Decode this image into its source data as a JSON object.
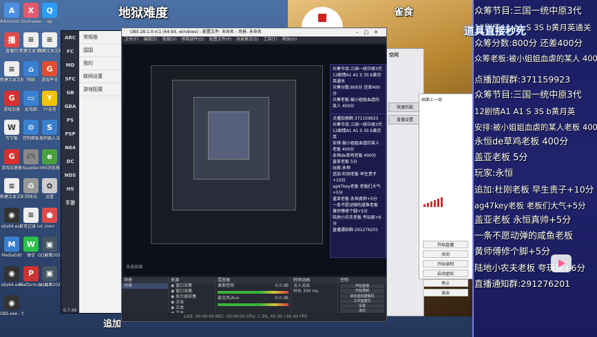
{
  "overlay": {
    "title_left": "地狱难度",
    "title_right": "雀食",
    "caption_float": "道具直接秒死",
    "bottom_text": "追加"
  },
  "desktop": {
    "icons": [
      {
        "label": "Administr...",
        "icon": "user-folder-icon",
        "color": "#4a8fe0",
        "glyph": "A"
      },
      {
        "label": "XiuXiuexe",
        "icon": "app-icon",
        "color": "#e05a6e",
        "glyph": "X"
      },
      {
        "label": "qq",
        "icon": "qq-icon",
        "color": "#2a9df4",
        "glyph": "Q"
      },
      {
        "label": "直播间",
        "icon": "live-icon",
        "color": "#e04a4a",
        "glyph": "播"
      },
      {
        "label": "新建文本文档(2).txt",
        "icon": "text-file-icon",
        "color": "#eeeeee",
        "glyph": "≡"
      },
      {
        "label": "新建文本文档.txt",
        "icon": "text-file-icon",
        "color": "#eeeeee",
        "glyph": "≡"
      },
      {
        "label": "新建文本文档(3).txt",
        "icon": "text-file-icon",
        "color": "#eeeeee",
        "glyph": "≡"
      },
      {
        "label": "网络",
        "icon": "network-icon",
        "color": "#3a80d0",
        "glyph": "⌂"
      },
      {
        "label": "游戏平台",
        "icon": "game-platform-icon",
        "color": "#e05030",
        "glyph": "G"
      },
      {
        "label": "游戏加速",
        "icon": "accelerator-icon",
        "color": "#d83030",
        "glyph": "G"
      },
      {
        "label": "此电脑",
        "icon": "computer-icon",
        "color": "#3a80d0",
        "glyph": "▭"
      },
      {
        "label": "YY语音",
        "icon": "yy-icon",
        "color": "#f2c200",
        "glyph": "Y"
      },
      {
        "label": "写字板",
        "icon": "wordpad-icon",
        "color": "#eeeeee",
        "glyph": "W"
      },
      {
        "label": "控制面板",
        "icon": "control-panel-icon",
        "color": "#3a80d0",
        "glyph": "⚙"
      },
      {
        "label": "搜狗输入法",
        "icon": "sogou-icon",
        "color": "#3a80d0",
        "glyph": "S"
      },
      {
        "label": "游戏加速器",
        "icon": "game-booster-icon",
        "color": "#d83030",
        "glyph": "G"
      },
      {
        "label": "Xpadder",
        "icon": "gamepad-icon",
        "color": "#888888",
        "glyph": "🎮"
      },
      {
        "label": "360浏览器",
        "icon": "browser-icon",
        "color": "#4aa040",
        "glyph": "e"
      },
      {
        "label": "新建文本文档(4).txt",
        "icon": "text-file-icon",
        "color": "#eeeeee",
        "glyph": "≡"
      },
      {
        "label": "回收站",
        "icon": "recycle-bin-icon",
        "color": "#999999",
        "glyph": "♻"
      },
      {
        "label": "设置",
        "icon": "settings-icon",
        "color": "#cccccc",
        "glyph": "✿"
      },
      {
        "label": "obs64.exe",
        "icon": "obs-icon",
        "color": "#333333",
        "glyph": "◉"
      },
      {
        "label": "日常记录.txt",
        "icon": "text-file-icon",
        "color": "#eeeeee",
        "glyph": "≡"
      },
      {
        "label": "mmr",
        "icon": "record-icon",
        "color": "#e04a4a",
        "glyph": "●"
      },
      {
        "label": "MediaEdit",
        "icon": "media-icon",
        "color": "#3a80d0",
        "glyph": "M"
      },
      {
        "label": "微信",
        "icon": "wechat-icon",
        "color": "#2cc04a",
        "glyph": "W"
      },
      {
        "label": "QQ截图20221...",
        "icon": "image-icon",
        "color": "#445566",
        "glyph": "▣"
      },
      {
        "label": "obs64.exe",
        "icon": "obs-icon",
        "color": "#333333",
        "glyph": "◉"
      },
      {
        "label": "Platform.exe",
        "icon": "platform-icon",
        "color": "#cc3333",
        "glyph": "P"
      },
      {
        "label": "QQ截图20221...",
        "icon": "image-icon",
        "color": "#445566",
        "glyph": "▣"
      },
      {
        "label": "OBS.exe - 快捷方式",
        "icon": "obs-icon",
        "color": "#333333",
        "glyph": "◉"
      }
    ]
  },
  "emulator": {
    "systems": [
      "ARC",
      "FC",
      "MD",
      "SFC",
      "GB",
      "GBA",
      "PS",
      "PSP",
      "N64",
      "DC",
      "NDS",
      "HS",
      "手游"
    ],
    "rows": [
      "常规版",
      "国国",
      "我的",
      "联网设置",
      "游戏配置"
    ],
    "version": "0.7.49"
  },
  "obs": {
    "title": "OBS 28.1.0-rc1 (64-bit, windows) - 配置文件: 未命名 - 场景: 未命名",
    "menu": [
      "文件(F)",
      "编辑(E)",
      "视图(V)",
      "停靠部件(D)",
      "配置文件(P)",
      "场景集合(S)",
      "工具(T)",
      "帮助(H)"
    ],
    "docks": {
      "scenes_header": "场景",
      "scenes": [
        "场景"
      ],
      "sources_header": "来源",
      "sources": [
        "窗口采集",
        "窗口采集",
        "显示器采集",
        "文本",
        "文本",
        "文本",
        "文本"
      ],
      "mixer_header": "混音器",
      "mixer": [
        "桌面音频",
        "麦克风/Aux"
      ],
      "mixer_db": "0.0 dB",
      "transitions_header": "转场动画",
      "transition": "淡入淡出",
      "duration_label": "时长",
      "duration": "300 ms",
      "controls_header": "控制",
      "controls": [
        "开始直播",
        "开始录制",
        "启动虚拟摄像机",
        "工作室模式",
        "设置",
        "退出"
      ]
    },
    "status": "LIVE: 00:00:00   REC: 00:00:00   CPU: 1.3%, 60.00 / 60.00 FPS",
    "no_source": "未选择源"
  },
  "dialog": {
    "title": "空间",
    "buttons": [
      "快速匹配",
      "直播设置"
    ],
    "label": "画面上一帧",
    "right_buttons": [
      "开始直播",
      "关闭",
      "开始录制",
      "启动虚拟",
      "停止",
      "退出"
    ]
  },
  "info_panel": {
    "lines": [
      "众筹节目:三国一统中原3代",
      "12剧情A1 A1 S 3S b黄月英通关",
      "众筹分数:800分 还差400分",
      "众筹老板:被小姐姐血虐的某人 400分",
      "",
      "点播加假群:371159923",
      "众筹节目:三国一统中原3代",
      "12剧情A1 A1 S 3S b黄月英",
      "安排:被小姐姐血虐的某人老板 400分",
      "永恒de草鸡老板 400分",
      "盖亚老板 5分",
      "玩家:永恒",
      "追加:杜刚老板 早生贵子+10分",
      "ag47key老板 老板们大气+5分",
      "盖亚老板 永恒真帅+5分",
      "一条不愿动弹的咸鱼老板",
      "黄师傅修个脚+5分",
      "陆地小农夫老板 夸玩家+6分",
      "直播通知群:291276201"
    ]
  },
  "colors": {
    "info_bg": "#1c1f63",
    "obs_bg": "#1e1f26",
    "accent": "#7a7fd8"
  }
}
